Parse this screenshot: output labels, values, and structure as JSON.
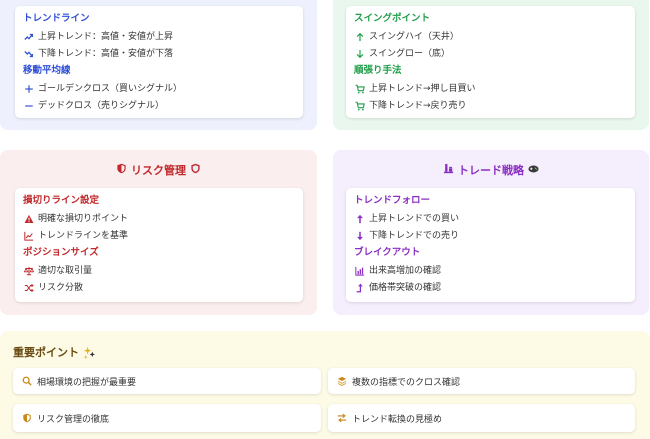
{
  "colors": {
    "blue": "#2f4fd6",
    "green": "#1f9e4a",
    "red": "#c0282b",
    "purple": "#8a2fc2",
    "gold": "#c8891a",
    "brown": "#6b4a12"
  },
  "trend_panel": {
    "trend_heading": "トレンドライン",
    "trend_items": [
      {
        "icon": "trend-up-icon",
        "label": "上昇トレンド：高値・安値が上昇"
      },
      {
        "icon": "trend-down-icon",
        "label": "下降トレンド：高値・安値が下落"
      }
    ],
    "ma_heading": "移動平均線",
    "ma_items": [
      {
        "icon": "plus-icon",
        "label": "ゴールデンクロス（買いシグナル）"
      },
      {
        "icon": "minus-icon",
        "label": "デッドクロス（売りシグナル）"
      }
    ]
  },
  "swing_panel": {
    "swing_heading": "スイングポイント",
    "swing_items": [
      {
        "icon": "arrow-up-icon",
        "label": "スイングハイ（天井）"
      },
      {
        "icon": "arrow-down-icon",
        "label": "スイングロー（底）"
      }
    ],
    "follow_heading": "順張り手法",
    "follow_items": [
      {
        "icon": "cart-icon",
        "label": "上昇トレンド→押し目買い"
      },
      {
        "icon": "cart-icon",
        "label": "下降トレンド→戻り売り"
      }
    ]
  },
  "risk_panel": {
    "title": "リスク管理",
    "stop_heading": "損切りライン設定",
    "stop_items": [
      {
        "icon": "warning-icon",
        "label": "明確な損切りポイント"
      },
      {
        "icon": "line-chart-icon",
        "label": "トレンドラインを基準"
      }
    ],
    "size_heading": "ポジションサイズ",
    "size_items": [
      {
        "icon": "scale-icon",
        "label": "適切な取引量"
      },
      {
        "icon": "shuffle-icon",
        "label": "リスク分散"
      }
    ]
  },
  "strategy_panel": {
    "title": "トレード戦略",
    "follow_heading": "トレンドフォロー",
    "follow_items": [
      {
        "icon": "arrow-up-icon",
        "label": "上昇トレンドでの買い"
      },
      {
        "icon": "arrow-down-icon",
        "label": "下降トレンドでの売り"
      }
    ],
    "breakout_heading": "ブレイクアウト",
    "breakout_items": [
      {
        "icon": "bar-chart-icon",
        "label": "出来高増加の確認"
      },
      {
        "icon": "level-up-icon",
        "label": "価格帯突破の確認"
      }
    ]
  },
  "key_points": {
    "title": "重要ポイント",
    "items": [
      {
        "icon": "search-icon",
        "label": "相場環境の把握が最重要"
      },
      {
        "icon": "layers-icon",
        "label": "複数の指標でのクロス確認"
      },
      {
        "icon": "shield-icon",
        "label": "リスク管理の徹底"
      },
      {
        "icon": "exchange-icon",
        "label": "トレンド転換の見極め"
      }
    ]
  }
}
